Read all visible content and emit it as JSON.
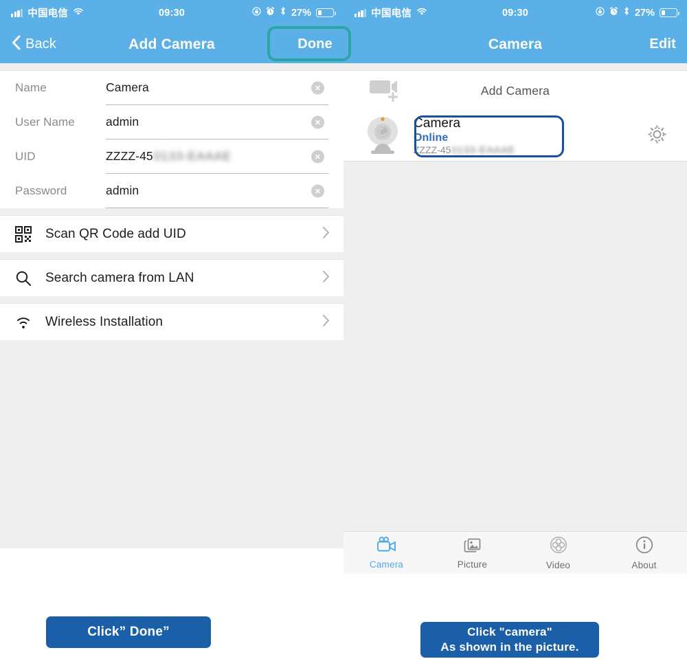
{
  "statusbar": {
    "carrier": "中国电信",
    "time": "09:30",
    "battery_pct": "27%",
    "signal_icon": "signal-bars-icon",
    "wifi_icon": "wifi-icon",
    "rotation_lock_icon": "rotation-lock-icon",
    "alarm_icon": "alarm-clock-icon",
    "bluetooth_icon": "bluetooth-icon",
    "battery_icon": "battery-icon"
  },
  "left_phone": {
    "nav": {
      "back_label": "Back",
      "back_icon": "chevron-left-icon",
      "title": "Add Camera",
      "done_label": "Done",
      "highlight_color": "#2BA6A6"
    },
    "form": {
      "fields": [
        {
          "label": "Name",
          "value": "Camera",
          "blurred": "",
          "clear_icon": "clear-circle-icon"
        },
        {
          "label": "User Name",
          "value": "admin",
          "blurred": "",
          "clear_icon": "clear-circle-icon"
        },
        {
          "label": "UID",
          "value": "ZZZZ-45",
          "blurred": "0133-EAAAE",
          "clear_icon": "clear-circle-icon"
        },
        {
          "label": "Password",
          "value": "admin",
          "blurred": "",
          "clear_icon": "clear-circle-icon"
        }
      ]
    },
    "menu_rows": [
      {
        "label": "Scan QR Code add UID",
        "icon": "qr-code-icon",
        "chevron": "chevron-right-icon"
      },
      {
        "label": "Search camera from LAN",
        "icon": "search-icon",
        "chevron": "chevron-right-icon"
      },
      {
        "label": "Wireless Installation",
        "icon": "wifi-icon",
        "chevron": "chevron-right-icon"
      }
    ]
  },
  "right_phone": {
    "nav": {
      "title": "Camera",
      "edit_label": "Edit"
    },
    "add_camera": {
      "label": "Add Camera",
      "icon": "camcorder-plus-icon"
    },
    "camera_item": {
      "name": "Camera",
      "status": "Online",
      "uid_prefix": "ZZZZ-45",
      "uid_blurred": "0133-EAAAE",
      "thumb_icon": "webcam-icon",
      "settings_icon": "gear-icon",
      "highlight_color": "#14539A",
      "status_color": "#2f6fbf"
    },
    "tabs": [
      {
        "label": "Camera",
        "icon": "camcorder-icon",
        "active": true
      },
      {
        "label": "Picture",
        "icon": "photos-icon",
        "active": false
      },
      {
        "label": "Video",
        "icon": "film-reel-icon",
        "active": false
      },
      {
        "label": "About",
        "icon": "info-icon",
        "active": false
      }
    ]
  },
  "captions": {
    "left": "Click” Done”",
    "right_line1": "Click \"camera\"",
    "right_line2": "As shown in the picture.",
    "color": "#1B5FA8"
  }
}
